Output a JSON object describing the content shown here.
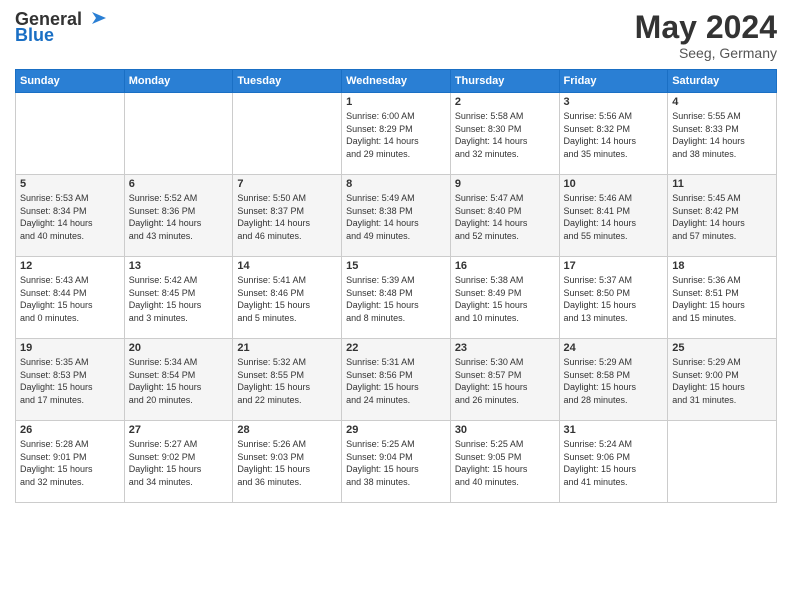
{
  "header": {
    "logo_general": "General",
    "logo_blue": "Blue",
    "month_year": "May 2024",
    "location": "Seeg, Germany"
  },
  "weekdays": [
    "Sunday",
    "Monday",
    "Tuesday",
    "Wednesday",
    "Thursday",
    "Friday",
    "Saturday"
  ],
  "weeks": [
    [
      {
        "day": "",
        "info": ""
      },
      {
        "day": "",
        "info": ""
      },
      {
        "day": "",
        "info": ""
      },
      {
        "day": "1",
        "info": "Sunrise: 6:00 AM\nSunset: 8:29 PM\nDaylight: 14 hours\nand 29 minutes."
      },
      {
        "day": "2",
        "info": "Sunrise: 5:58 AM\nSunset: 8:30 PM\nDaylight: 14 hours\nand 32 minutes."
      },
      {
        "day": "3",
        "info": "Sunrise: 5:56 AM\nSunset: 8:32 PM\nDaylight: 14 hours\nand 35 minutes."
      },
      {
        "day": "4",
        "info": "Sunrise: 5:55 AM\nSunset: 8:33 PM\nDaylight: 14 hours\nand 38 minutes."
      }
    ],
    [
      {
        "day": "5",
        "info": "Sunrise: 5:53 AM\nSunset: 8:34 PM\nDaylight: 14 hours\nand 40 minutes."
      },
      {
        "day": "6",
        "info": "Sunrise: 5:52 AM\nSunset: 8:36 PM\nDaylight: 14 hours\nand 43 minutes."
      },
      {
        "day": "7",
        "info": "Sunrise: 5:50 AM\nSunset: 8:37 PM\nDaylight: 14 hours\nand 46 minutes."
      },
      {
        "day": "8",
        "info": "Sunrise: 5:49 AM\nSunset: 8:38 PM\nDaylight: 14 hours\nand 49 minutes."
      },
      {
        "day": "9",
        "info": "Sunrise: 5:47 AM\nSunset: 8:40 PM\nDaylight: 14 hours\nand 52 minutes."
      },
      {
        "day": "10",
        "info": "Sunrise: 5:46 AM\nSunset: 8:41 PM\nDaylight: 14 hours\nand 55 minutes."
      },
      {
        "day": "11",
        "info": "Sunrise: 5:45 AM\nSunset: 8:42 PM\nDaylight: 14 hours\nand 57 minutes."
      }
    ],
    [
      {
        "day": "12",
        "info": "Sunrise: 5:43 AM\nSunset: 8:44 PM\nDaylight: 15 hours\nand 0 minutes."
      },
      {
        "day": "13",
        "info": "Sunrise: 5:42 AM\nSunset: 8:45 PM\nDaylight: 15 hours\nand 3 minutes."
      },
      {
        "day": "14",
        "info": "Sunrise: 5:41 AM\nSunset: 8:46 PM\nDaylight: 15 hours\nand 5 minutes."
      },
      {
        "day": "15",
        "info": "Sunrise: 5:39 AM\nSunset: 8:48 PM\nDaylight: 15 hours\nand 8 minutes."
      },
      {
        "day": "16",
        "info": "Sunrise: 5:38 AM\nSunset: 8:49 PM\nDaylight: 15 hours\nand 10 minutes."
      },
      {
        "day": "17",
        "info": "Sunrise: 5:37 AM\nSunset: 8:50 PM\nDaylight: 15 hours\nand 13 minutes."
      },
      {
        "day": "18",
        "info": "Sunrise: 5:36 AM\nSunset: 8:51 PM\nDaylight: 15 hours\nand 15 minutes."
      }
    ],
    [
      {
        "day": "19",
        "info": "Sunrise: 5:35 AM\nSunset: 8:53 PM\nDaylight: 15 hours\nand 17 minutes."
      },
      {
        "day": "20",
        "info": "Sunrise: 5:34 AM\nSunset: 8:54 PM\nDaylight: 15 hours\nand 20 minutes."
      },
      {
        "day": "21",
        "info": "Sunrise: 5:32 AM\nSunset: 8:55 PM\nDaylight: 15 hours\nand 22 minutes."
      },
      {
        "day": "22",
        "info": "Sunrise: 5:31 AM\nSunset: 8:56 PM\nDaylight: 15 hours\nand 24 minutes."
      },
      {
        "day": "23",
        "info": "Sunrise: 5:30 AM\nSunset: 8:57 PM\nDaylight: 15 hours\nand 26 minutes."
      },
      {
        "day": "24",
        "info": "Sunrise: 5:29 AM\nSunset: 8:58 PM\nDaylight: 15 hours\nand 28 minutes."
      },
      {
        "day": "25",
        "info": "Sunrise: 5:29 AM\nSunset: 9:00 PM\nDaylight: 15 hours\nand 31 minutes."
      }
    ],
    [
      {
        "day": "26",
        "info": "Sunrise: 5:28 AM\nSunset: 9:01 PM\nDaylight: 15 hours\nand 32 minutes."
      },
      {
        "day": "27",
        "info": "Sunrise: 5:27 AM\nSunset: 9:02 PM\nDaylight: 15 hours\nand 34 minutes."
      },
      {
        "day": "28",
        "info": "Sunrise: 5:26 AM\nSunset: 9:03 PM\nDaylight: 15 hours\nand 36 minutes."
      },
      {
        "day": "29",
        "info": "Sunrise: 5:25 AM\nSunset: 9:04 PM\nDaylight: 15 hours\nand 38 minutes."
      },
      {
        "day": "30",
        "info": "Sunrise: 5:25 AM\nSunset: 9:05 PM\nDaylight: 15 hours\nand 40 minutes."
      },
      {
        "day": "31",
        "info": "Sunrise: 5:24 AM\nSunset: 9:06 PM\nDaylight: 15 hours\nand 41 minutes."
      },
      {
        "day": "",
        "info": ""
      }
    ]
  ]
}
